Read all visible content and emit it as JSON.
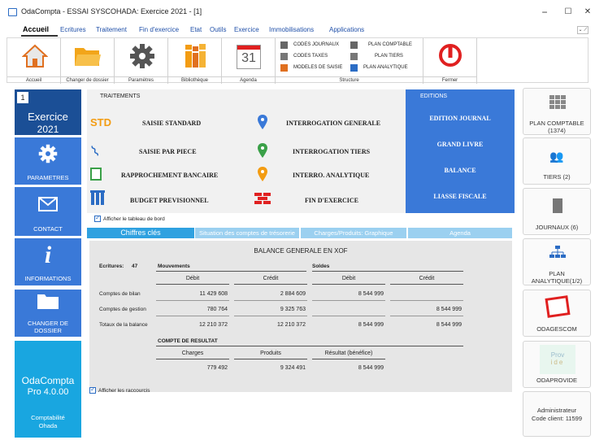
{
  "window": {
    "title": "OdaCompta  - ESSAI SYSCOHADA: Exercice 2021 - [1]",
    "minimize": "−",
    "maximize": "☐",
    "close": "✕"
  },
  "menu": [
    "Accueil",
    "Ecritures",
    "Traitement",
    "Fin d'exercice",
    "Etat",
    "Outils",
    "Exercice",
    "Immobilisations",
    "Applications"
  ],
  "ribbon": {
    "groups": [
      "Accueil",
      "Changer de dossier",
      "Paramètres",
      "Bibliothèque",
      "Agenda",
      "Structure",
      "Fermer"
    ],
    "agenda_day": "31",
    "structure_items": [
      "CODES JOURNAUX",
      "CODES TAXES",
      "MODELES DE SAISIE",
      "PLAN COMPTABLE",
      "PLAN TIERS",
      "PLAN ANALYTIQUE"
    ],
    "collapse": "⌄ ⟋"
  },
  "left": {
    "exercise_num": "1",
    "exercise_label": "Exercice",
    "exercise_year": "2021",
    "parametres": "PARAMETRES",
    "contact": "CONTACT",
    "informations": "INFORMATIONS",
    "changer": "CHANGER DE DOSSIER",
    "brand": "OdaCompta",
    "version": "Pro 4.0.00",
    "brand_sub": "Comptabilité Ohada"
  },
  "treatments": {
    "title": "TRAITEMENTS",
    "std": "STD",
    "items": [
      "SAISIE STANDARD",
      "SAISIE PAR PIECE",
      "RAPPROCHEMENT BANCAIRE",
      "BUDGET PREVISIONNEL",
      "INTERROGATION GENERALE",
      "INTERROGATION TIERS",
      "INTERRO. ANALYTIQUE",
      "FIN D'EXERCICE"
    ]
  },
  "editions": {
    "title": "EDITIONS",
    "items": [
      "EDITION JOURNAL",
      "GRAND LIVRE",
      "BALANCE",
      "LIASSE FISCALE"
    ]
  },
  "dashboard_checkbox": "Afficher le tableau de bord",
  "shortcuts_checkbox": "Afficher les raccourcis",
  "tabs": [
    "Chiffres clés",
    "Situation des comptes de trésorerie",
    "Charges/Produits: Graphique",
    "Agenda"
  ],
  "balance": {
    "title": "BALANCE GENERALE EN XOF",
    "ecritures_label": "Ecritures:",
    "ecritures_count": "47",
    "mouvements": "Mouvements",
    "soldes": "Soldes",
    "debit": "Débit",
    "credit": "Crédit",
    "rows": [
      {
        "label": "Comptes de bilan",
        "mvt_debit": "11 429 608",
        "mvt_credit": "2 884 609",
        "sol_debit": "8 544 999",
        "sol_credit": ""
      },
      {
        "label": "Comptes de gestion",
        "mvt_debit": "780 764",
        "mvt_credit": "9 325 763",
        "sol_debit": "",
        "sol_credit": "8 544 999"
      },
      {
        "label": "Totaux de la balance",
        "mvt_debit": "12 210 372",
        "mvt_credit": "12 210 372",
        "sol_debit": "8 544 999",
        "sol_credit": "8 544 999"
      }
    ],
    "resultat_title": "COMPTE DE RESULTAT",
    "charges": "Charges",
    "produits": "Produits",
    "resultat": "Résultat (bénéfice)",
    "charges_val": "779 492",
    "produits_val": "9 324 491",
    "resultat_val": "8 544 999"
  },
  "right": {
    "plan_comptable": "PLAN COMPTABLE",
    "plan_comptable_count": "(1374)",
    "tiers": "TIERS (2)",
    "journaux": "JOURNAUX (6)",
    "plan_analytique": "PLAN",
    "plan_analytique2": "ANALYTIQUE(1/2)",
    "odagescom": "ODAGESCOM",
    "odaprovide": "ODAPROVIDE",
    "odaprovide_logo1": "Prov",
    "odaprovide_logo2": "ide",
    "admin": "Administrateur",
    "code_client": "Code client: 11599"
  },
  "colors": {
    "blue": "#3a79d8",
    "navy": "#1b4f96",
    "cyan": "#19a6e0",
    "orange": "#f39c12",
    "red": "#e02020"
  }
}
